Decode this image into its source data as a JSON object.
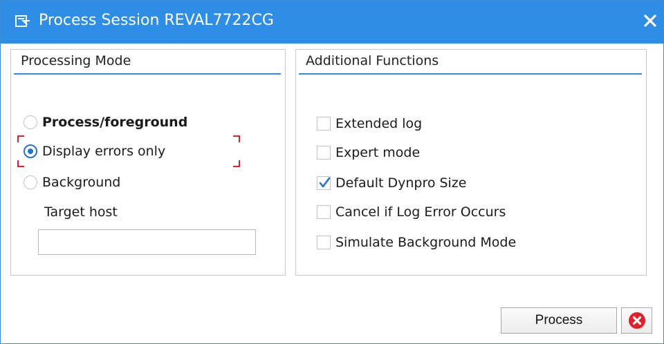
{
  "window": {
    "title": "Process Session REVAL7722CG",
    "title_icon": "session-icon",
    "close_icon": "close-icon",
    "titlebar_color": "#2e8ee6"
  },
  "processing_mode": {
    "title": "Processing Mode",
    "options": [
      {
        "label": "Process/foreground",
        "selected": false,
        "bold": true
      },
      {
        "label": "Display errors only",
        "selected": true,
        "focused": true
      },
      {
        "label": "Background",
        "selected": false
      }
    ],
    "target_host": {
      "label": "Target host",
      "value": ""
    }
  },
  "additional_functions": {
    "title": "Additional Functions",
    "options": [
      {
        "label": "Extended log",
        "checked": false
      },
      {
        "label": "Expert mode",
        "checked": false
      },
      {
        "label": "Default Dynpro Size",
        "checked": true
      },
      {
        "label": "Cancel if Log Error Occurs",
        "checked": false
      },
      {
        "label": "Simulate Background Mode",
        "checked": false
      }
    ]
  },
  "buttons": {
    "process_label": "Process",
    "cancel_icon": "cancel-icon"
  },
  "colors": {
    "accent": "#2e8ee6",
    "radio_selected": "#1f73d4",
    "focus_marker": "#d8232a",
    "cancel_red": "#e0202a"
  }
}
